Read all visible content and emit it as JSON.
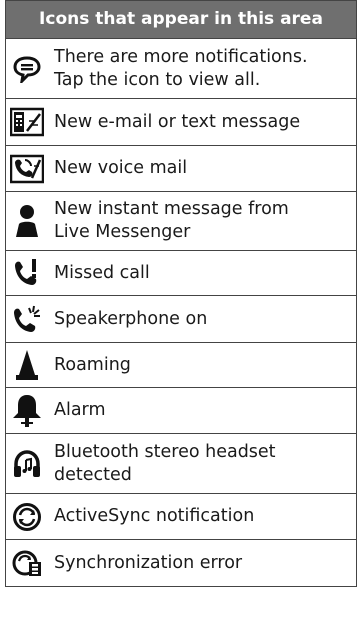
{
  "header": {
    "title": "Icons that appear in this area"
  },
  "rows": [
    {
      "icon": "more-notifications-icon",
      "lines": [
        "There are more notifications.",
        "Tap the icon to view all."
      ]
    },
    {
      "icon": "new-email-text-icon",
      "lines": [
        "New e-mail or text message"
      ]
    },
    {
      "icon": "voicemail-icon",
      "lines": [
        "New voice mail"
      ]
    },
    {
      "icon": "instant-message-person-icon",
      "lines": [
        "New instant message from",
        "Live Messenger"
      ]
    },
    {
      "icon": "missed-call-icon",
      "lines": [
        "Missed call"
      ]
    },
    {
      "icon": "speakerphone-icon",
      "lines": [
        "Speakerphone on"
      ]
    },
    {
      "icon": "roaming-icon",
      "lines": [
        "Roaming"
      ]
    },
    {
      "icon": "alarm-bell-icon",
      "lines": [
        "Alarm"
      ]
    },
    {
      "icon": "stereo-headset-icon",
      "lines": [
        "Bluetooth stereo headset",
        "detected"
      ]
    },
    {
      "icon": "activesync-icon",
      "lines": [
        "ActiveSync notification"
      ]
    },
    {
      "icon": "sync-error-icon",
      "lines": [
        "Synchronization error"
      ]
    }
  ]
}
